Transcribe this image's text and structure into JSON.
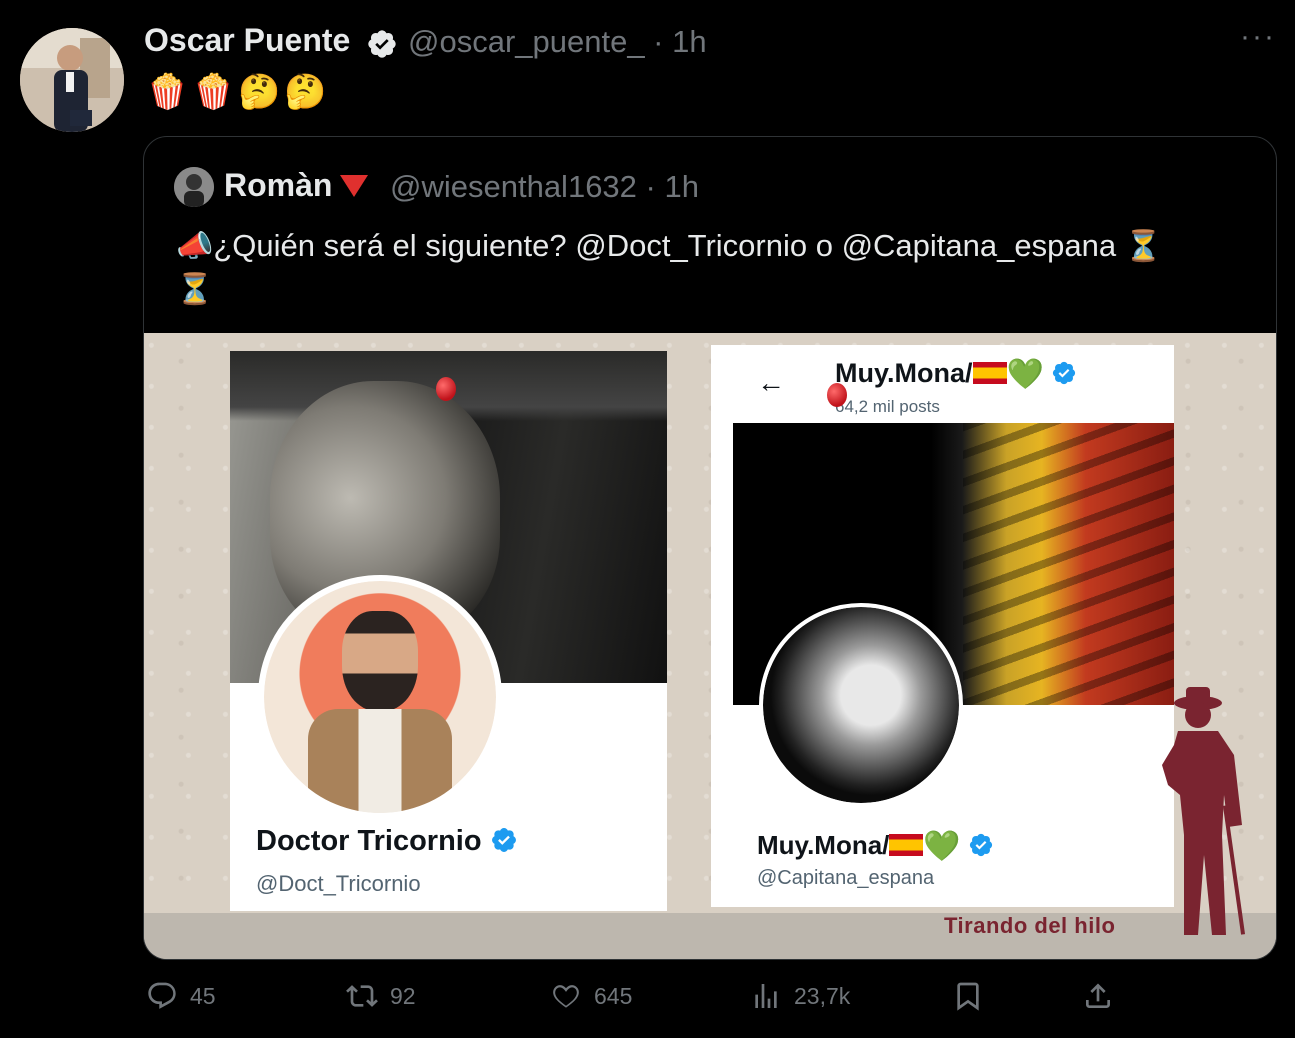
{
  "tweet": {
    "author_name": "Oscar Puente",
    "author_handle": "@oscar_puente_ · 1h",
    "more_label": "···",
    "emojis": [
      "🍿",
      "🍿",
      "🤔",
      "🤔"
    ]
  },
  "quote": {
    "author_name": "Romàn",
    "author_handle": "@wiesenthal1632 · 1h",
    "text_emoji_start": "📣",
    "text": "¿Quién será el siguiente? @Doct_Tricornio o @Capitana_espana",
    "text_emoji_end_1": "⏳",
    "text_emoji_end_2": "⏳"
  },
  "media": {
    "card1": {
      "name": "Doctor Tricornio",
      "handle": "@Doct_Tricornio"
    },
    "card2": {
      "back": "←",
      "title": "Muy.Mona/",
      "posts": "64,2 mil posts",
      "name": "Muy.Mona/",
      "handle": "@Capitana_espana",
      "heart": "💚"
    },
    "brand_text": "Tirando del hilo"
  },
  "actions": {
    "replies": "45",
    "reposts": "92",
    "likes": "645",
    "views": "23,7k"
  },
  "colors": {
    "background": "#000000",
    "text_primary": "#e7e9ea",
    "text_secondary": "#71767b",
    "verified_blue": "#1d9bf0",
    "border": "#2f3336"
  },
  "icons": [
    "verified-badge-icon",
    "more-icon",
    "reply-icon",
    "repost-icon",
    "like-icon",
    "views-icon",
    "bookmark-icon",
    "share-icon",
    "back-arrow-icon"
  ]
}
